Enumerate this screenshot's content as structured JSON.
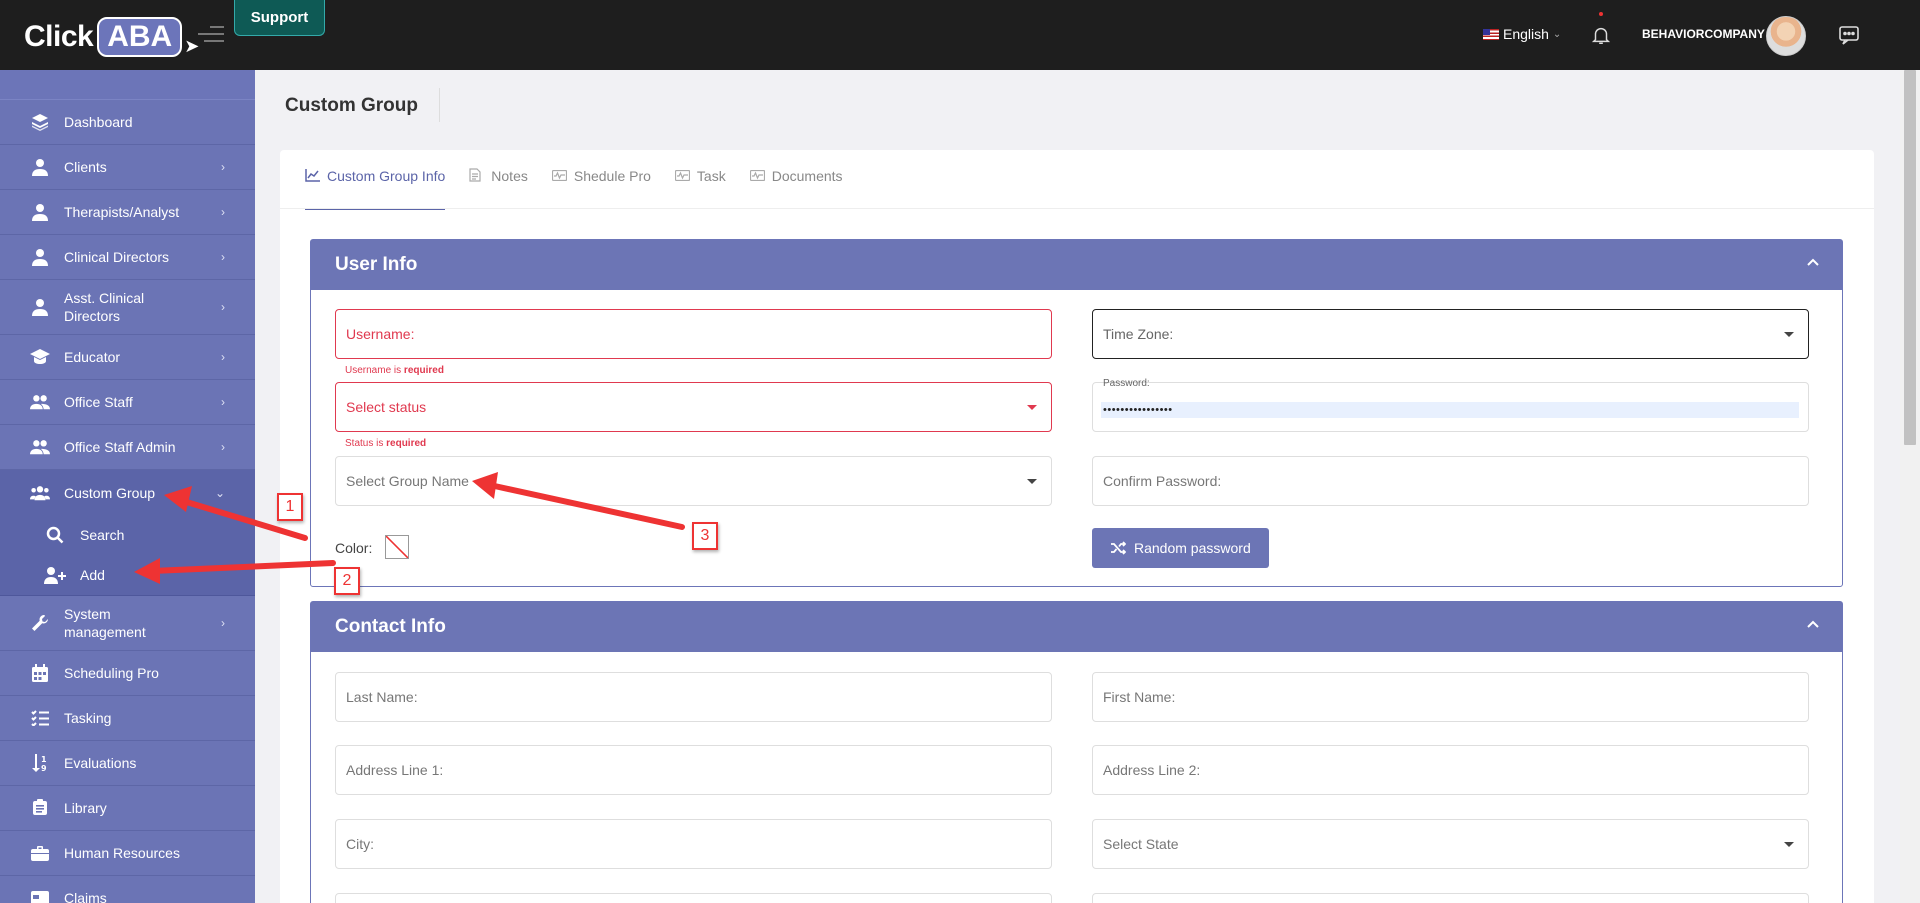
{
  "header": {
    "logo_click": "Click",
    "logo_aba": "ABA",
    "support_label": "Support",
    "language": "English",
    "username": "BEHAVIORCOMPANY"
  },
  "sidebar": {
    "items": [
      {
        "label": "Dashboard",
        "icon": "layers-icon",
        "has_arrow": false
      },
      {
        "label": "Clients",
        "icon": "user-icon",
        "has_arrow": true
      },
      {
        "label": "Therapists/Analyst",
        "icon": "user-tie-icon",
        "has_arrow": true
      },
      {
        "label": "Clinical Directors",
        "icon": "user-tie-icon",
        "has_arrow": true
      },
      {
        "label": "Asst. Clinical Directors",
        "icon": "user-tie-icon",
        "has_arrow": true
      },
      {
        "label": "Educator",
        "icon": "graduation-cap-icon",
        "has_arrow": true
      },
      {
        "label": "Office Staff",
        "icon": "users-icon",
        "has_arrow": true
      },
      {
        "label": "Office Staff Admin",
        "icon": "users-icon",
        "has_arrow": true
      },
      {
        "label": "Custom Group",
        "icon": "users-group-icon",
        "has_arrow": true
      },
      {
        "label": "System management",
        "icon": "wrench-icon",
        "has_arrow": true
      },
      {
        "label": "Scheduling Pro",
        "icon": "calendar-icon",
        "has_arrow": false
      },
      {
        "label": "Tasking",
        "icon": "task-list-icon",
        "has_arrow": false
      },
      {
        "label": "Evaluations",
        "icon": "sort-icon",
        "has_arrow": false
      },
      {
        "label": "Library",
        "icon": "library-icon",
        "has_arrow": false
      },
      {
        "label": "Human Resources",
        "icon": "briefcase-icon",
        "has_arrow": false
      },
      {
        "label": "Claims",
        "icon": "card-icon",
        "has_arrow": false
      }
    ],
    "custom_group_sub": [
      {
        "label": "Search",
        "icon": "search-icon"
      },
      {
        "label": "Add",
        "icon": "user-plus-icon"
      }
    ]
  },
  "page": {
    "title": "Custom Group"
  },
  "tabs": [
    {
      "label": "Custom Group Info",
      "icon": "chart-icon",
      "active": true
    },
    {
      "label": "Notes",
      "icon": "document-icon",
      "active": false
    },
    {
      "label": "Shedule Pro",
      "icon": "wave-icon",
      "active": false
    },
    {
      "label": "Task",
      "icon": "wave-icon",
      "active": false
    },
    {
      "label": "Documents",
      "icon": "wave-icon",
      "active": false
    }
  ],
  "user_info": {
    "title": "User Info",
    "username_placeholder": "Username:",
    "username_error_prefix": "Username is",
    "username_error_bold": "required",
    "status_placeholder": "Select status",
    "status_error_prefix": "Status is",
    "status_error_bold": "required",
    "group_placeholder": "Select Group Name",
    "color_label": "Color:",
    "timezone_placeholder": "Time Zone:",
    "password_label": "Password:",
    "password_value": "••••••••••••••••",
    "confirm_password_placeholder": "Confirm Password:",
    "random_password_label": "Random password"
  },
  "contact_info": {
    "title": "Contact Info",
    "last_name": "Last Name:",
    "first_name": "First Name:",
    "address1": "Address Line 1:",
    "address2": "Address Line 2:",
    "city": "City:",
    "state": "Select State"
  },
  "annotations": [
    "1",
    "2",
    "3"
  ],
  "colors": {
    "accent": "#6c75b5",
    "sidebar": "#6b74b5",
    "error": "#e0394f",
    "annotation": "#ee3333"
  }
}
